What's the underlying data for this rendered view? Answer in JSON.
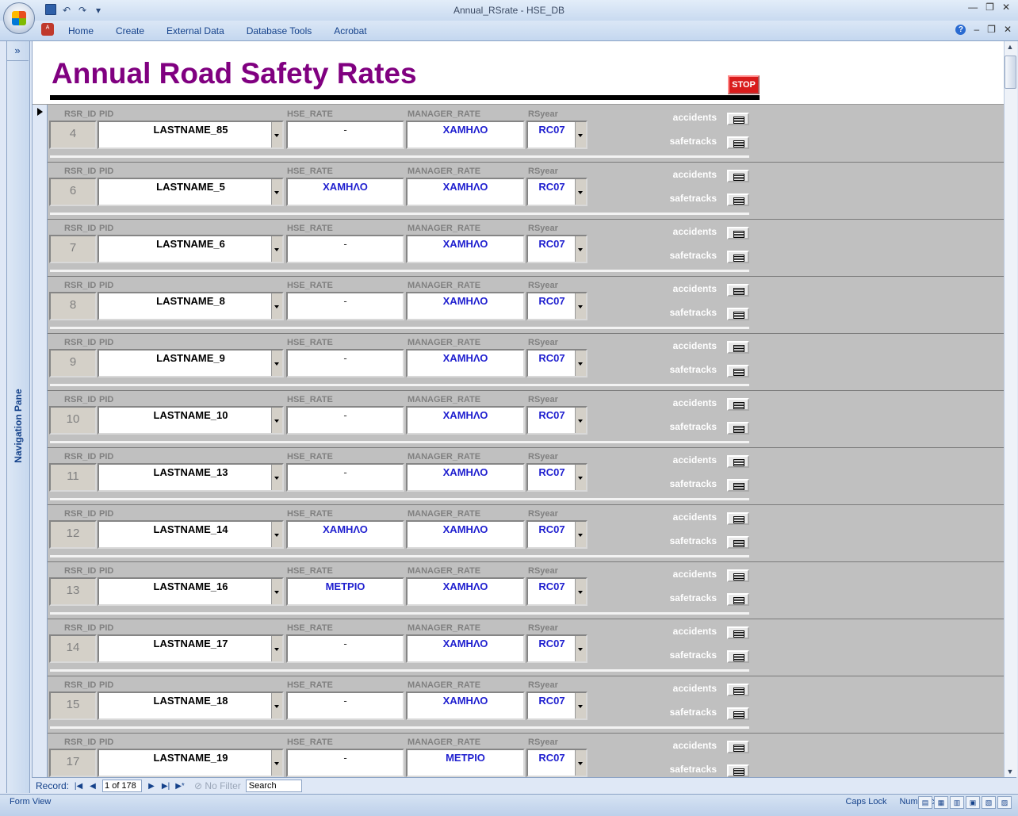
{
  "window": {
    "title": "Annual_RSrate - HSE_DB"
  },
  "ribbon": {
    "tabs": [
      "Home",
      "Create",
      "External Data",
      "Database Tools",
      "Acrobat"
    ]
  },
  "nav_pane": {
    "label": "Navigation Pane"
  },
  "form": {
    "title": "Annual Road Safety Rates",
    "stop_label": "STOP",
    "labels": {
      "id": "RSR_ID",
      "pid": "PID",
      "hse": "HSE_RATE",
      "manager": "MANAGER_RATE",
      "year": "RSyear",
      "accidents": "accidents",
      "safetracks": "safetracks"
    },
    "records": [
      {
        "id": "4",
        "pid": "LASTNAME_85",
        "hse": "-",
        "manager": "ΧΑΜΗΛΟ",
        "year": "RC07"
      },
      {
        "id": "6",
        "pid": "LASTNAME_5",
        "hse": "ΧΑΜΗΛΟ",
        "manager": "ΧΑΜΗΛΟ",
        "year": "RC07"
      },
      {
        "id": "7",
        "pid": "LASTNAME_6",
        "hse": "-",
        "manager": "ΧΑΜΗΛΟ",
        "year": "RC07"
      },
      {
        "id": "8",
        "pid": "LASTNAME_8",
        "hse": "-",
        "manager": "ΧΑΜΗΛΟ",
        "year": "RC07"
      },
      {
        "id": "9",
        "pid": "LASTNAME_9",
        "hse": "-",
        "manager": "ΧΑΜΗΛΟ",
        "year": "RC07"
      },
      {
        "id": "10",
        "pid": "LASTNAME_10",
        "hse": "-",
        "manager": "ΧΑΜΗΛΟ",
        "year": "RC07"
      },
      {
        "id": "11",
        "pid": "LASTNAME_13",
        "hse": "-",
        "manager": "ΧΑΜΗΛΟ",
        "year": "RC07"
      },
      {
        "id": "12",
        "pid": "LASTNAME_14",
        "hse": "ΧΑΜΗΛΟ",
        "manager": "ΧΑΜΗΛΟ",
        "year": "RC07"
      },
      {
        "id": "13",
        "pid": "LASTNAME_16",
        "hse": "ΜΕΤΡΙΟ",
        "manager": "ΧΑΜΗΛΟ",
        "year": "RC07"
      },
      {
        "id": "14",
        "pid": "LASTNAME_17",
        "hse": "-",
        "manager": "ΧΑΜΗΛΟ",
        "year": "RC07"
      },
      {
        "id": "15",
        "pid": "LASTNAME_18",
        "hse": "-",
        "manager": "ΧΑΜΗΛΟ",
        "year": "RC07"
      },
      {
        "id": "17",
        "pid": "LASTNAME_19",
        "hse": "-",
        "manager": "ΜΕΤΡΙΟ",
        "year": "RC07"
      }
    ]
  },
  "record_nav": {
    "label": "Record:",
    "current": "1 of 178",
    "filter": "No Filter",
    "search": "Search"
  },
  "status": {
    "view": "Form View",
    "caps": "Caps Lock",
    "num": "Num Lock"
  }
}
